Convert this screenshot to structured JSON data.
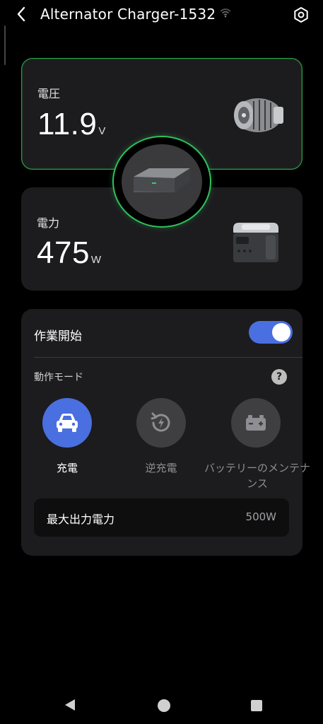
{
  "header": {
    "title": "Alternator Charger-1532",
    "back_icon": "chevron-left-icon",
    "wifi_icon": "wifi-icon",
    "settings_icon": "hexagon-gear-icon"
  },
  "voltage": {
    "label": "電圧",
    "value": "11.9",
    "unit": "V",
    "image": "alternator-image"
  },
  "device": {
    "image": "alternator-charger-device-image",
    "ring_color": "#2fc15a"
  },
  "power": {
    "label": "電力",
    "value": "475",
    "unit": "W",
    "image": "power-station-image"
  },
  "controls": {
    "work_start_label": "作業開始",
    "work_start_enabled": true,
    "mode_label": "動作モード",
    "help_label": "?",
    "modes": [
      {
        "label": "充電",
        "icon": "car-icon",
        "selected": true
      },
      {
        "label": "逆充電",
        "icon": "reverse-charge-icon",
        "selected": false
      },
      {
        "label": "バッテリーのメンテナンス",
        "icon": "battery-icon",
        "selected": false
      }
    ],
    "max_output_label": "最大出力電力",
    "max_output_value": "500W"
  },
  "colors": {
    "accent": "#4a6fe0",
    "card": "#1c1c1e",
    "green": "#2fc15a"
  }
}
